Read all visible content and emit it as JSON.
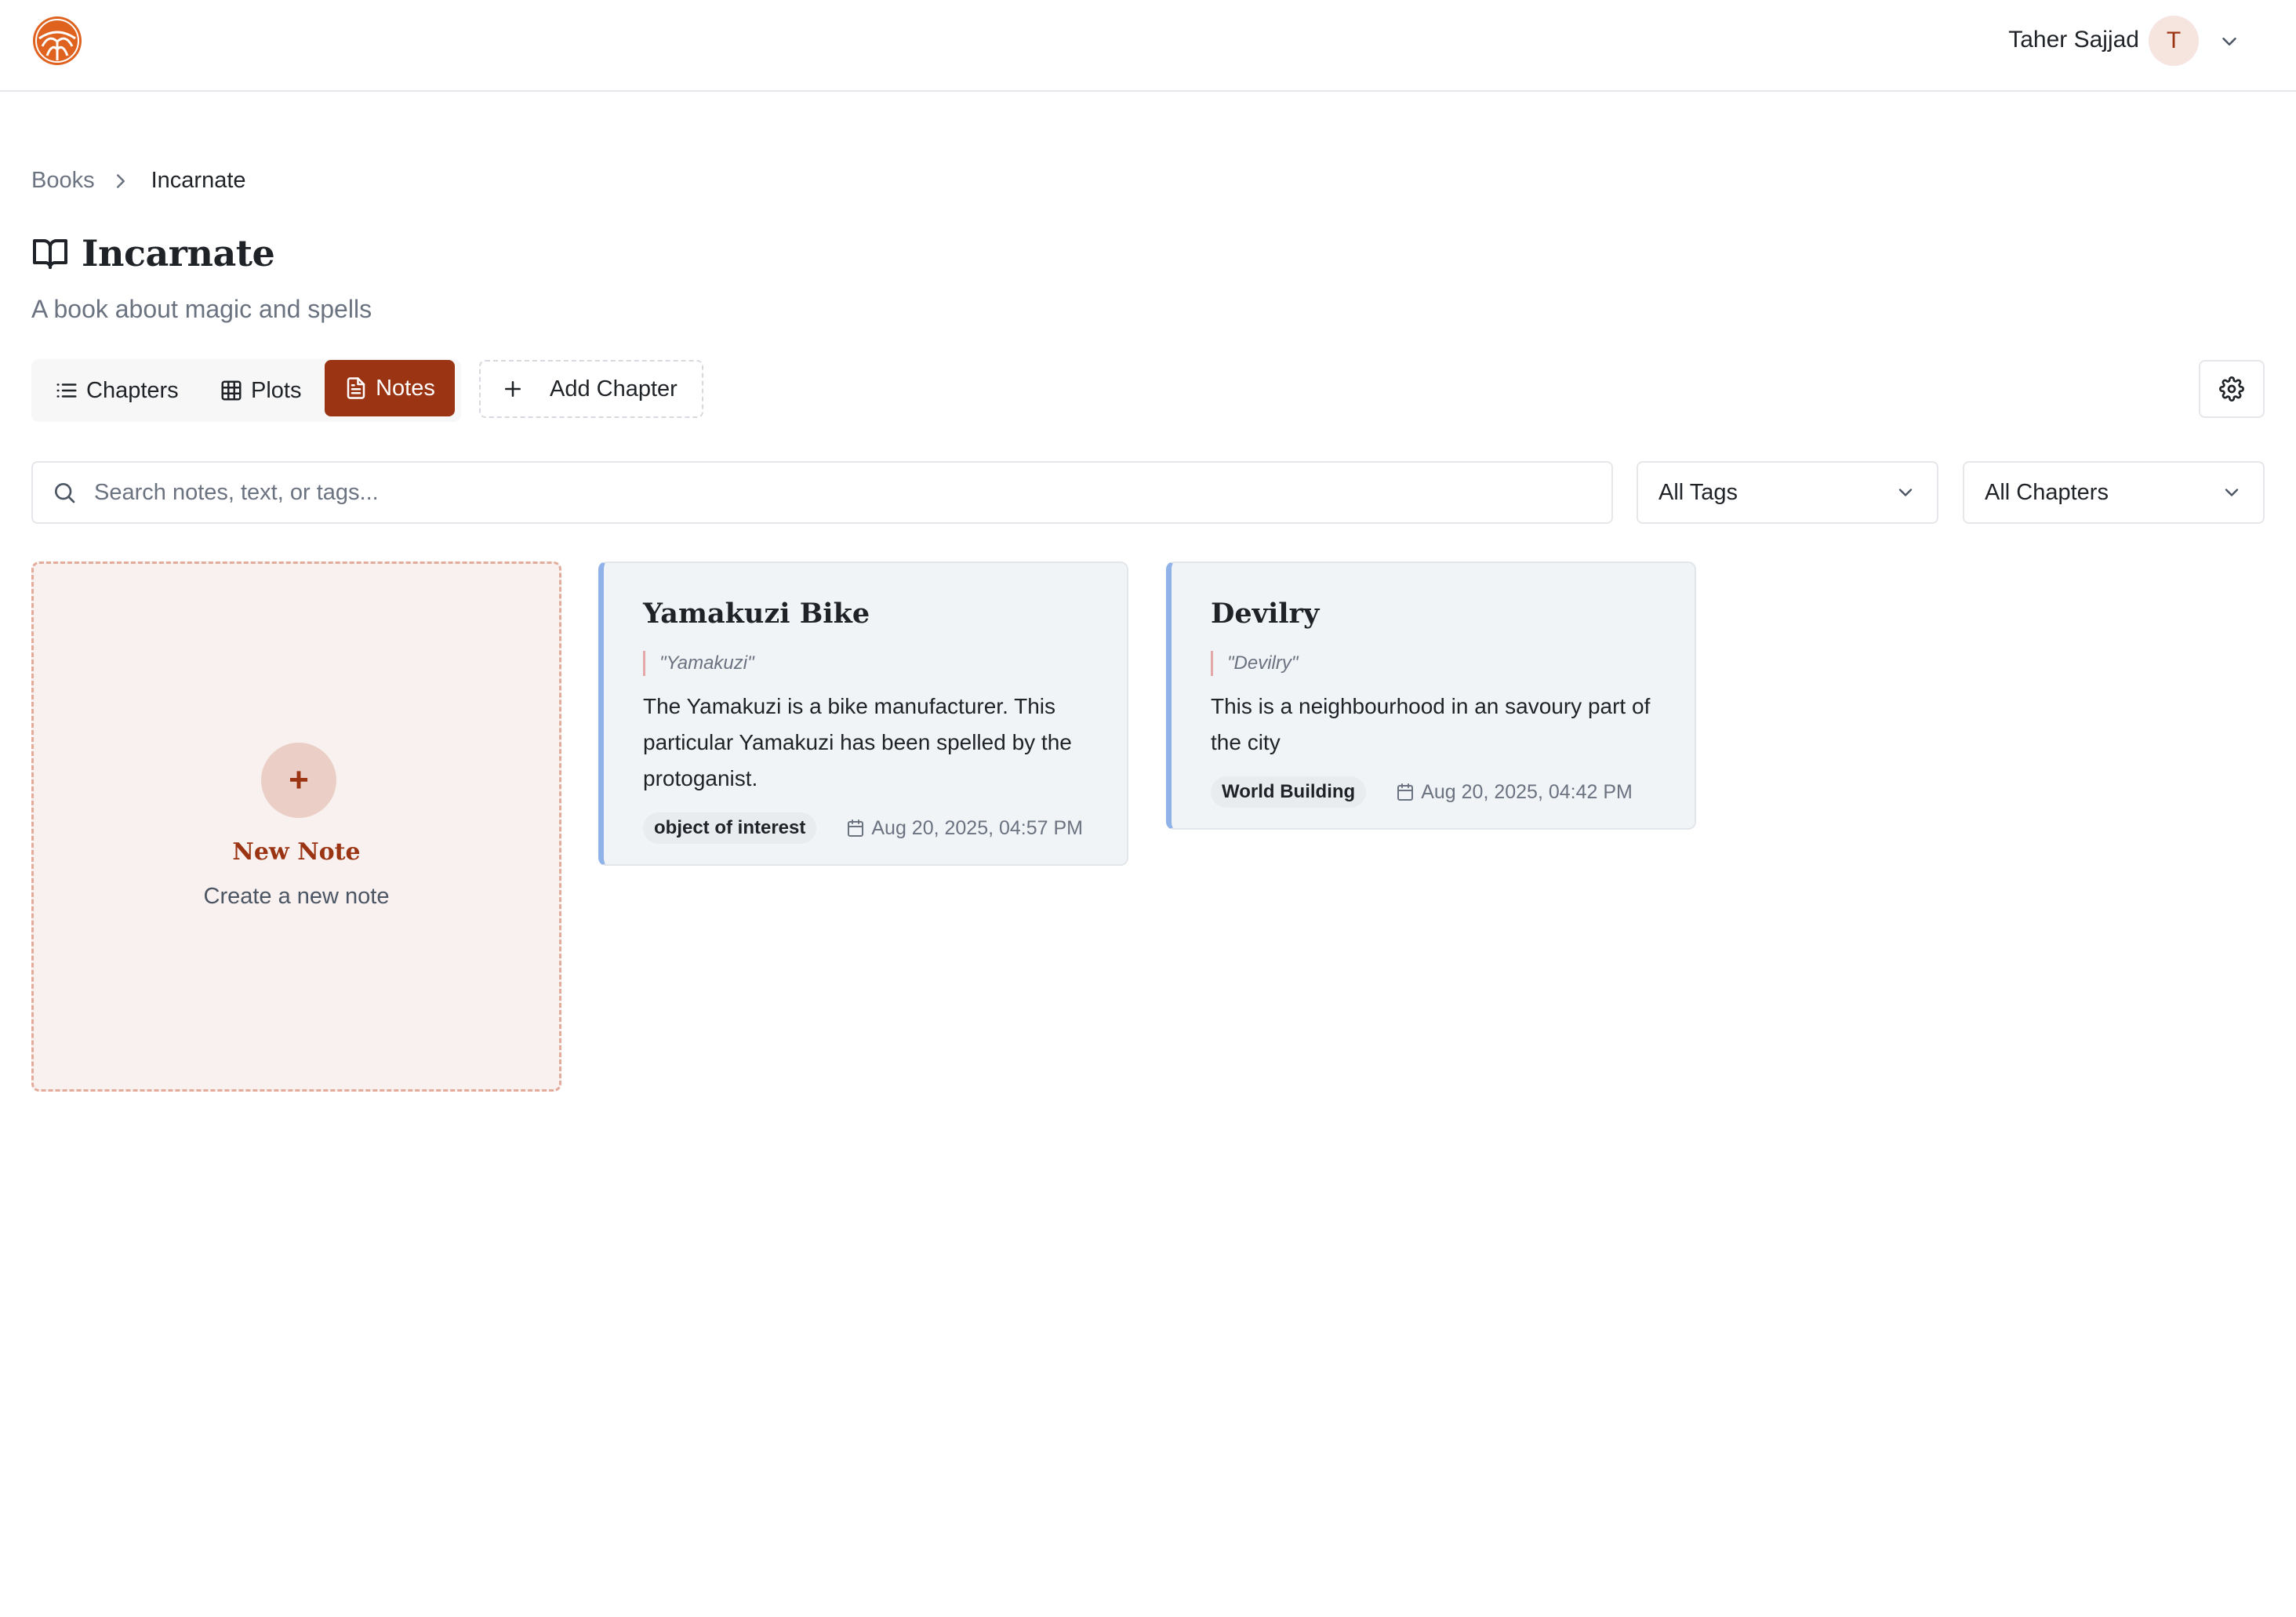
{
  "header": {
    "user_name": "Taher Sajjad",
    "avatar_initial": "T"
  },
  "breadcrumb": {
    "root": "Books",
    "current": "Incarnate"
  },
  "book": {
    "title": "Incarnate",
    "description": "A book about magic and spells"
  },
  "tabs": [
    {
      "label": "Chapters",
      "icon": "list-icon",
      "active": false
    },
    {
      "label": "Plots",
      "icon": "grid-icon",
      "active": false
    },
    {
      "label": "Notes",
      "icon": "document-icon",
      "active": true
    }
  ],
  "toolbar": {
    "add_chapter_label": "Add Chapter",
    "settings_icon": "gear-icon"
  },
  "filters": {
    "search_placeholder": "Search notes, text, or tags...",
    "search_value": "",
    "tags_selected": "All Tags",
    "chapters_selected": "All Chapters"
  },
  "new_note": {
    "plus": "+",
    "title": "New Note",
    "subtitle": "Create a new note"
  },
  "notes": [
    {
      "title": "Yamakuzi Bike",
      "quote": "\"Yamakuzi\"",
      "body": "The Yamakuzi is a bike manufacturer. This particular Yamakuzi has been spelled by the protoganist.",
      "tag": "object of interest",
      "date": "Aug 20, 2025, 04:57 PM"
    },
    {
      "title": "Devilry",
      "quote": "\"Devilry\"",
      "body": "This is a neighbourhood in an savoury part of the city",
      "tag": "World Building",
      "date": "Aug 20, 2025, 04:42 PM"
    }
  ],
  "colors": {
    "accent": "#9a3412",
    "note_border": "#8fb3e8",
    "new_note_bg": "#f8f1ef"
  }
}
